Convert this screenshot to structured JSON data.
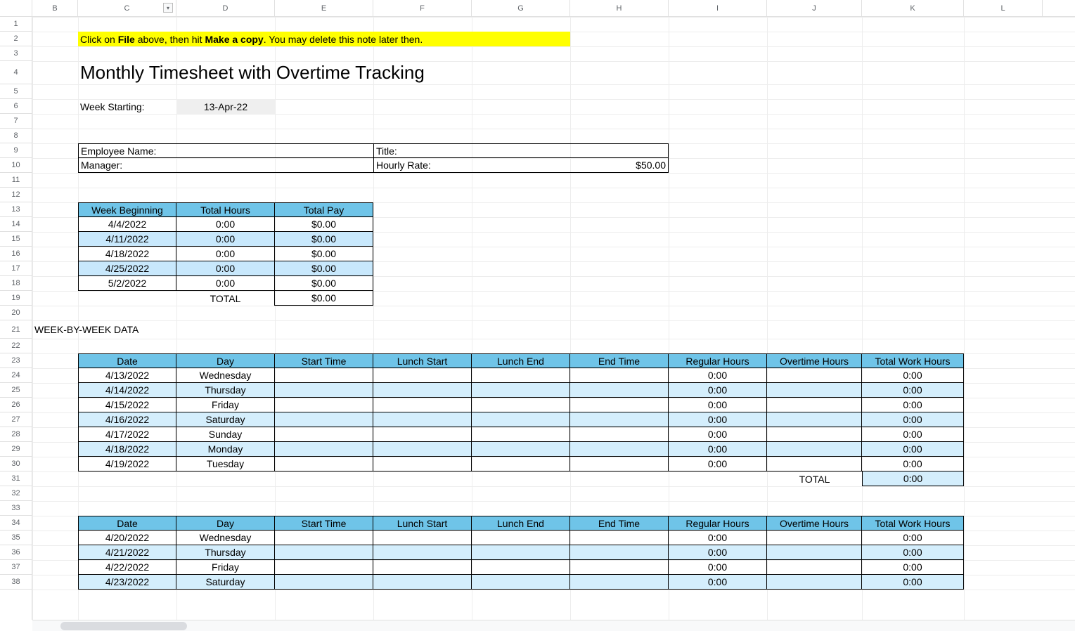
{
  "columns": [
    "B",
    "C",
    "D",
    "E",
    "F",
    "G",
    "H",
    "I",
    "J",
    "K",
    "L"
  ],
  "col_dropdown_on": "C",
  "rows": 38,
  "note": {
    "pre": "Click on ",
    "b1": "File",
    "mid": " above, then hit ",
    "b2": "Make a copy",
    "post": ". You may delete this note later then."
  },
  "title": "Monthly Timesheet with Overtime Tracking",
  "week_starting_label": "Week Starting:",
  "week_starting_value": "13-Apr-22",
  "info": {
    "employee_name_label": "Employee Name:",
    "title_label": "Title:",
    "manager_label": "Manager:",
    "hourly_rate_label": "Hourly Rate:",
    "hourly_rate_value": "$50.00"
  },
  "summary_headers": {
    "week": "Week Beginning",
    "hours": "Total Hours",
    "pay": "Total Pay"
  },
  "summary": [
    {
      "week": "4/4/2022",
      "hours": "0:00",
      "pay": "$0.00"
    },
    {
      "week": "4/11/2022",
      "hours": "0:00",
      "pay": "$0.00"
    },
    {
      "week": "4/18/2022",
      "hours": "0:00",
      "pay": "$0.00"
    },
    {
      "week": "4/25/2022",
      "hours": "0:00",
      "pay": "$0.00"
    },
    {
      "week": "5/2/2022",
      "hours": "0:00",
      "pay": "$0.00"
    }
  ],
  "summary_total_label": "TOTAL",
  "summary_total_pay": "$0.00",
  "wbw_label": "WEEK-BY-WEEK DATA",
  "week_headers": {
    "date": "Date",
    "day": "Day",
    "start": "Start Time",
    "lstart": "Lunch Start",
    "lend": "Lunch End",
    "end": "End Time",
    "reg": "Regular Hours",
    "ot": "Overtime Hours",
    "total": "Total Work Hours"
  },
  "week1": [
    {
      "date": "4/13/2022",
      "day": "Wednesday",
      "reg": "0:00",
      "total": "0:00"
    },
    {
      "date": "4/14/2022",
      "day": "Thursday",
      "reg": "0:00",
      "total": "0:00"
    },
    {
      "date": "4/15/2022",
      "day": "Friday",
      "reg": "0:00",
      "total": "0:00"
    },
    {
      "date": "4/16/2022",
      "day": "Saturday",
      "reg": "0:00",
      "total": "0:00"
    },
    {
      "date": "4/17/2022",
      "day": "Sunday",
      "reg": "0:00",
      "total": "0:00"
    },
    {
      "date": "4/18/2022",
      "day": "Monday",
      "reg": "0:00",
      "total": "0:00"
    },
    {
      "date": "4/19/2022",
      "day": "Tuesday",
      "reg": "0:00",
      "total": "0:00"
    }
  ],
  "week1_total_label": "TOTAL",
  "week1_total_value": "0:00",
  "week2": [
    {
      "date": "4/20/2022",
      "day": "Wednesday",
      "reg": "0:00",
      "total": "0:00"
    },
    {
      "date": "4/21/2022",
      "day": "Thursday",
      "reg": "0:00",
      "total": "0:00"
    },
    {
      "date": "4/22/2022",
      "day": "Friday",
      "reg": "0:00",
      "total": "0:00"
    },
    {
      "date": "4/23/2022",
      "day": "Saturday",
      "reg": "0:00",
      "total": "0:00"
    }
  ]
}
